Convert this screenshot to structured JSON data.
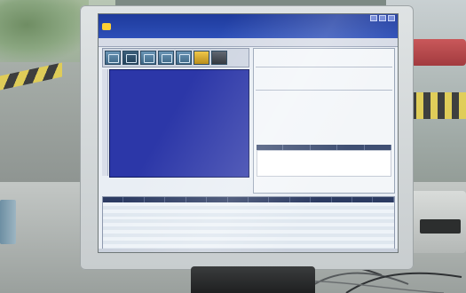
{
  "app": {
    "window_title": "",
    "name": "",
    "subtitle": ""
  },
  "menubar": {
    "right_text": ""
  },
  "toolbar": {
    "buttons": [
      "bus-icon",
      "map-icon",
      "monitor-icon",
      "list-icon",
      "settings-icon",
      "alert-icon",
      "user-icon"
    ]
  },
  "info_panel": {
    "station": "",
    "station_right": "",
    "rows": [
      "",
      "",
      "",
      "",
      "",
      "",
      "",
      ""
    ],
    "grid_headers": [
      "",
      "",
      "",
      "",
      ""
    ],
    "footer": [
      "",
      ""
    ]
  },
  "table": {
    "headers": [
      "",
      "",
      "",
      "",
      "",
      "",
      "",
      "",
      "",
      "",
      "",
      "",
      "",
      ""
    ],
    "row_count": 14
  },
  "colors": {
    "titlebar": "#1e3a9c",
    "video_panel": "#2c37a8",
    "table_header": "#2c3b62",
    "monitor_bezel": "#d5d9db"
  }
}
